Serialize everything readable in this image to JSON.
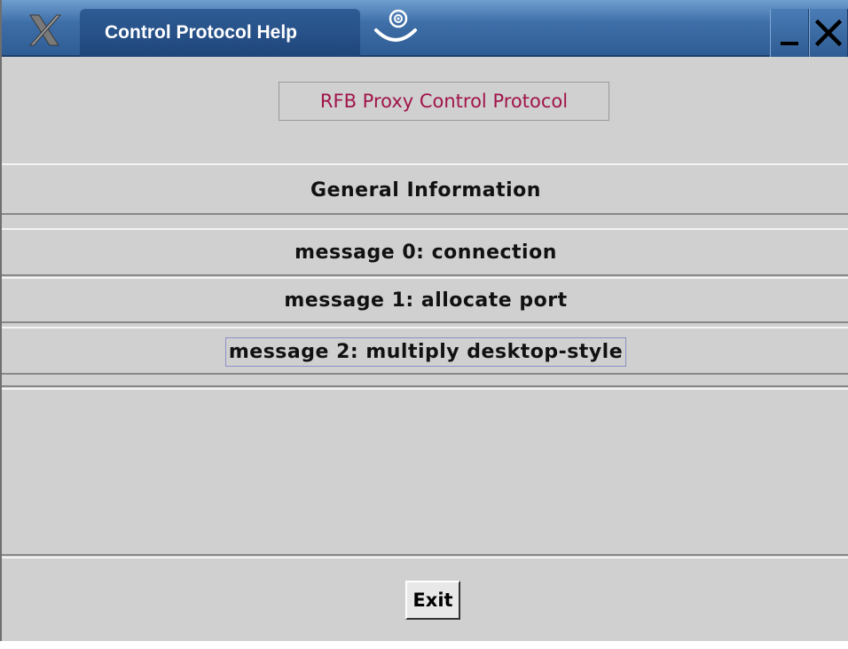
{
  "window": {
    "title": "Control Protocol Help",
    "minimize_label": "_",
    "close_label": "X",
    "icons": [
      "x-logo-icon",
      "java-duke-icon"
    ]
  },
  "header": {
    "label": "RFB Proxy Control Protocol",
    "color": "#a0144a"
  },
  "topics": [
    {
      "label": "General Information"
    },
    {
      "label": "message 0: connection"
    },
    {
      "label": "message 1: allocate port"
    },
    {
      "label": "message 2: multiply desktop-style"
    }
  ],
  "footer": {
    "exit_label": "Exit"
  }
}
